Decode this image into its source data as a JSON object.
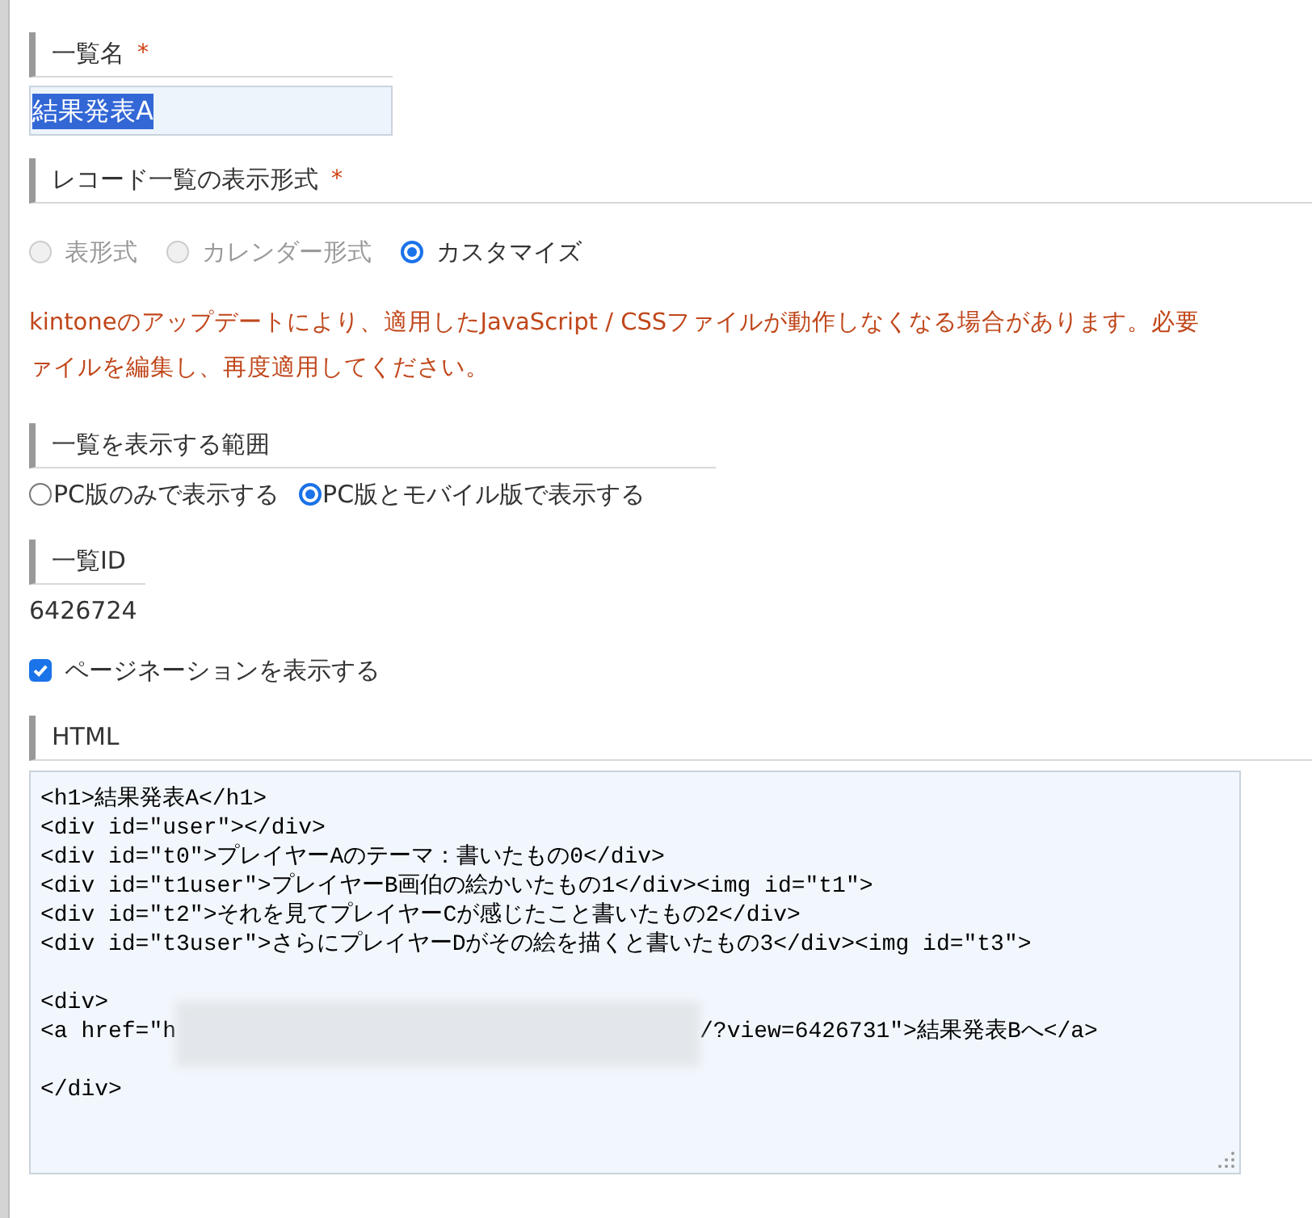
{
  "list_name": {
    "label": "一覧名",
    "required_mark": "*",
    "value": "結果発表A",
    "text_selected": true
  },
  "display_format": {
    "label": "レコード一覧の表示形式",
    "required_mark": "*",
    "options": [
      {
        "label": "表形式",
        "selected": false,
        "disabled": true
      },
      {
        "label": "カレンダー形式",
        "selected": false,
        "disabled": true
      },
      {
        "label": "カスタマイズ",
        "selected": true,
        "disabled": false
      }
    ]
  },
  "warning": [
    "kintoneのアップデートにより、適用したJavaScript / CSSファイルが動作しなくなる場合があります。必要",
    "ァイルを編集し、再度適用してください。"
  ],
  "display_scope": {
    "label": "一覧を表示する範囲",
    "options": [
      {
        "label": "PC版のみで表示する",
        "selected": false
      },
      {
        "label": "PC版とモバイル版で表示する",
        "selected": true
      }
    ]
  },
  "list_id": {
    "label": "一覧ID",
    "value": "6426724"
  },
  "pagination": {
    "label": "ページネーションを表示する",
    "checked": true
  },
  "html": {
    "label": "HTML",
    "lines": [
      {
        "kind": "text",
        "text": "<h1>結果発表A</h1>"
      },
      {
        "kind": "text",
        "text": "<div id=\"user\"></div>"
      },
      {
        "kind": "text",
        "text": "<div id=\"t0\">プレイヤーAのテーマ：書いたもの0</div>"
      },
      {
        "kind": "text",
        "text": "<div id=\"t1user\">プレイヤーB画伯の絵かいたもの1</div><img id=\"t1\">"
      },
      {
        "kind": "text",
        "text": "<div id=\"t2\">それを見てプレイヤーCが感じたこと書いたもの2</div>"
      },
      {
        "kind": "text",
        "text": "<div id=\"t3user\">さらにプレイヤーDがその絵を描くと書いたもの3</div><img id=\"t3\">"
      },
      {
        "kind": "blank"
      },
      {
        "kind": "text",
        "text": "<div>"
      },
      {
        "kind": "redacted",
        "before": "<a href=\"h",
        "after": "/?view=6426731\">結果発表Bへ</a>"
      },
      {
        "kind": "blank"
      },
      {
        "kind": "text",
        "text": "</div>"
      }
    ]
  }
}
